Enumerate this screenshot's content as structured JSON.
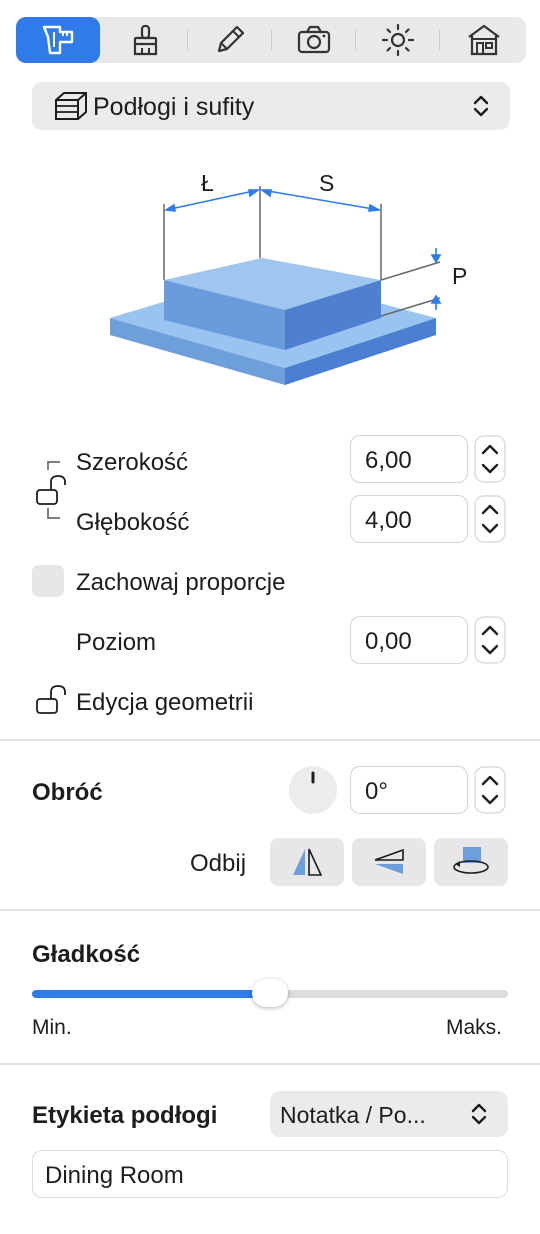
{
  "toolbar": {
    "tools": [
      "measure-tool-icon",
      "brush-icon",
      "pencil-icon",
      "camera-icon",
      "sun-icon",
      "house-icon"
    ],
    "active": "measure-tool-icon",
    "accent": "#2f7bea"
  },
  "object_type": {
    "label": "Podłogi i sufity"
  },
  "diagram": {
    "dim_l": "Ł",
    "dim_s": "S",
    "dim_p": "P"
  },
  "dimensions": {
    "width_label": "Szerokość",
    "width_value": "6,00",
    "depth_label": "Głębokość",
    "depth_value": "4,00",
    "keep_proportions_label": "Zachowaj proporcje",
    "level_label": "Poziom",
    "level_value": "0,00",
    "edit_geometry_label": "Edycja geometrii"
  },
  "rotate": {
    "label": "Obróć",
    "value": "0°",
    "mirror_label": "Odbij"
  },
  "smoothness": {
    "label": "Gładkość",
    "min_label": "Min.",
    "max_label": "Maks.",
    "value_fraction": 0.5
  },
  "floor_label": {
    "label": "Etykieta podłogi",
    "selected": "Notatka / Po...",
    "text": "Dining Room"
  }
}
